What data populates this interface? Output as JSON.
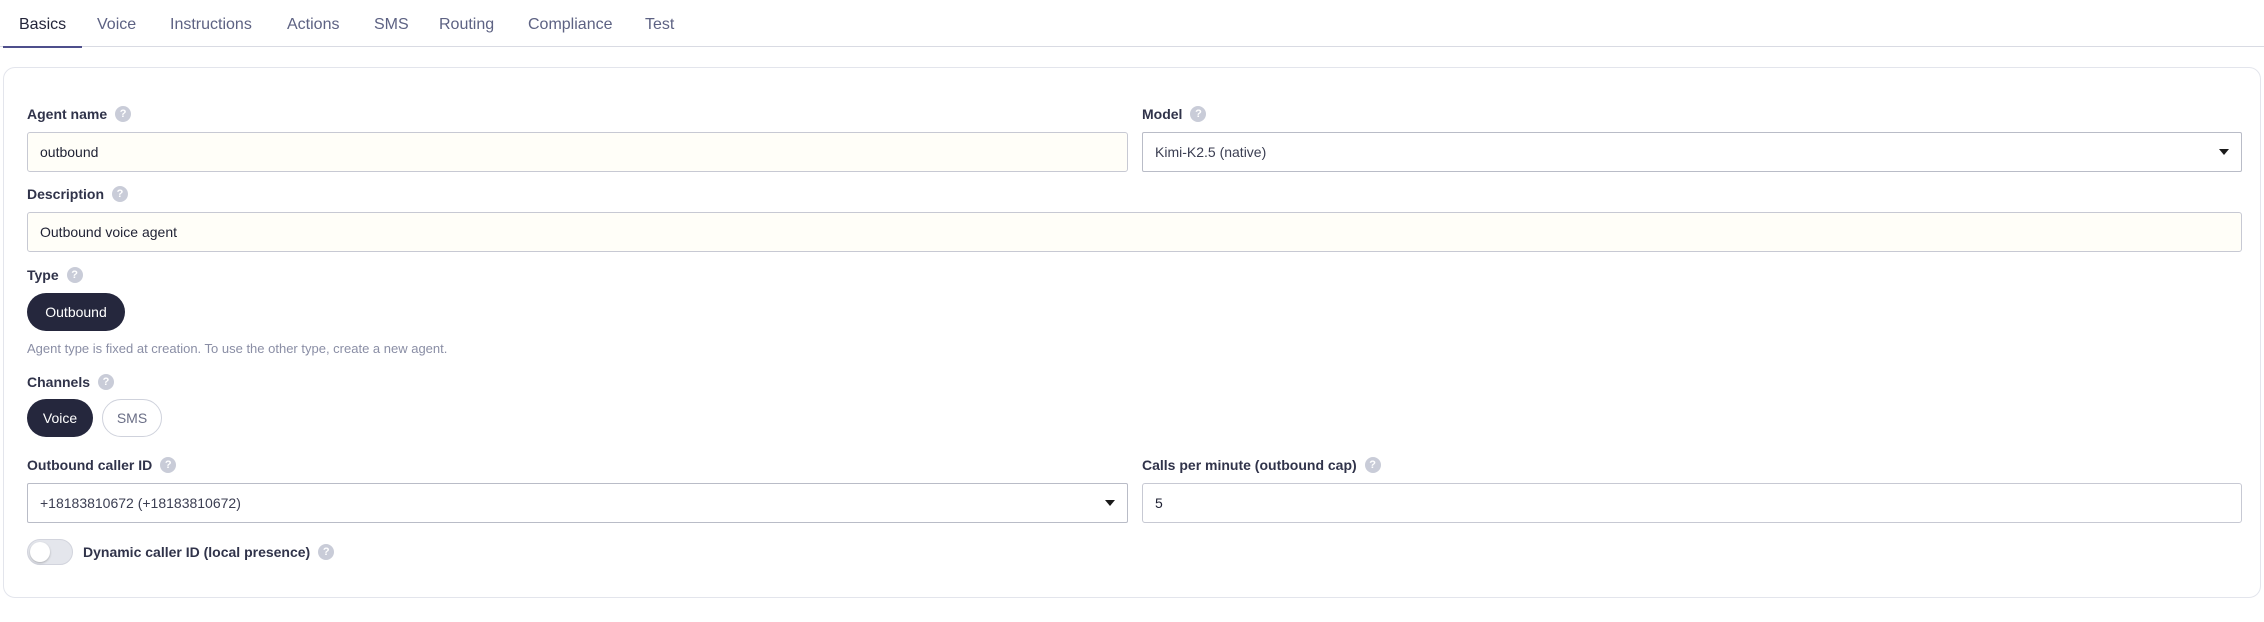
{
  "tabs": [
    {
      "label": "Basics",
      "active": true
    },
    {
      "label": "Voice"
    },
    {
      "label": "Instructions"
    },
    {
      "label": "Actions"
    },
    {
      "label": "SMS"
    },
    {
      "label": "Routing"
    },
    {
      "label": "Compliance"
    },
    {
      "label": "Test"
    }
  ],
  "form": {
    "agent_name": {
      "label": "Agent name",
      "value": "outbound"
    },
    "model": {
      "label": "Model",
      "value": "Kimi-K2.5 (native)"
    },
    "description": {
      "label": "Description",
      "value": "Outbound voice agent"
    },
    "type": {
      "label": "Type",
      "selected": "Outbound",
      "hint": "Agent type is fixed at creation. To use the other type, create a new agent."
    },
    "channels": {
      "label": "Channels",
      "options": [
        {
          "label": "Voice",
          "selected": true
        },
        {
          "label": "SMS",
          "selected": false
        }
      ]
    },
    "caller_id": {
      "label": "Outbound caller ID",
      "value": "+18183810672 (+18183810672)"
    },
    "calls_per_minute": {
      "label": "Calls per minute (outbound cap)",
      "value": "5"
    },
    "dynamic_caller_id": {
      "label": "Dynamic caller ID (local presence)",
      "enabled": false
    }
  },
  "icons": {
    "help": "question-mark-icon",
    "dropdown": "caret-down-icon"
  },
  "help_glyph": "?",
  "colors": {
    "accent": "#4e4f8c",
    "pill_selected": "#25273d"
  }
}
